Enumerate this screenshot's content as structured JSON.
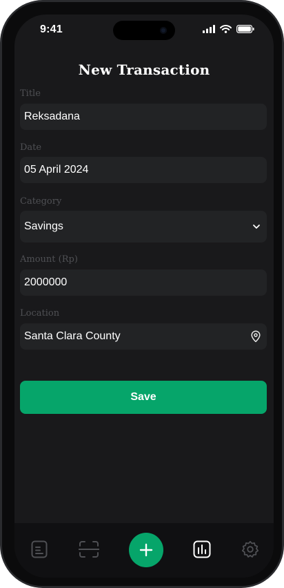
{
  "status_bar": {
    "time": "9:41"
  },
  "header": {
    "title": "New Transaction"
  },
  "form": {
    "title_label": "Title",
    "title_value": "Reksadana",
    "date_label": "Date",
    "date_value": "05 April 2024",
    "category_label": "Category",
    "category_value": "Savings",
    "amount_label": "Amount (Rp)",
    "amount_value": "2000000",
    "location_label": "Location",
    "location_value": "Santa Clara County"
  },
  "actions": {
    "save_label": "Save"
  },
  "bottom_nav": {
    "items": [
      {
        "icon": "document-icon",
        "active": false
      },
      {
        "icon": "scan-icon",
        "active": false
      },
      {
        "icon": "plus-icon",
        "active": true
      },
      {
        "icon": "chart-icon",
        "active": true
      },
      {
        "icon": "gear-icon",
        "active": false
      }
    ]
  },
  "colors": {
    "accent": "#06a56a",
    "background": "#19191b",
    "field": "#222325",
    "label": "#4f5054"
  }
}
